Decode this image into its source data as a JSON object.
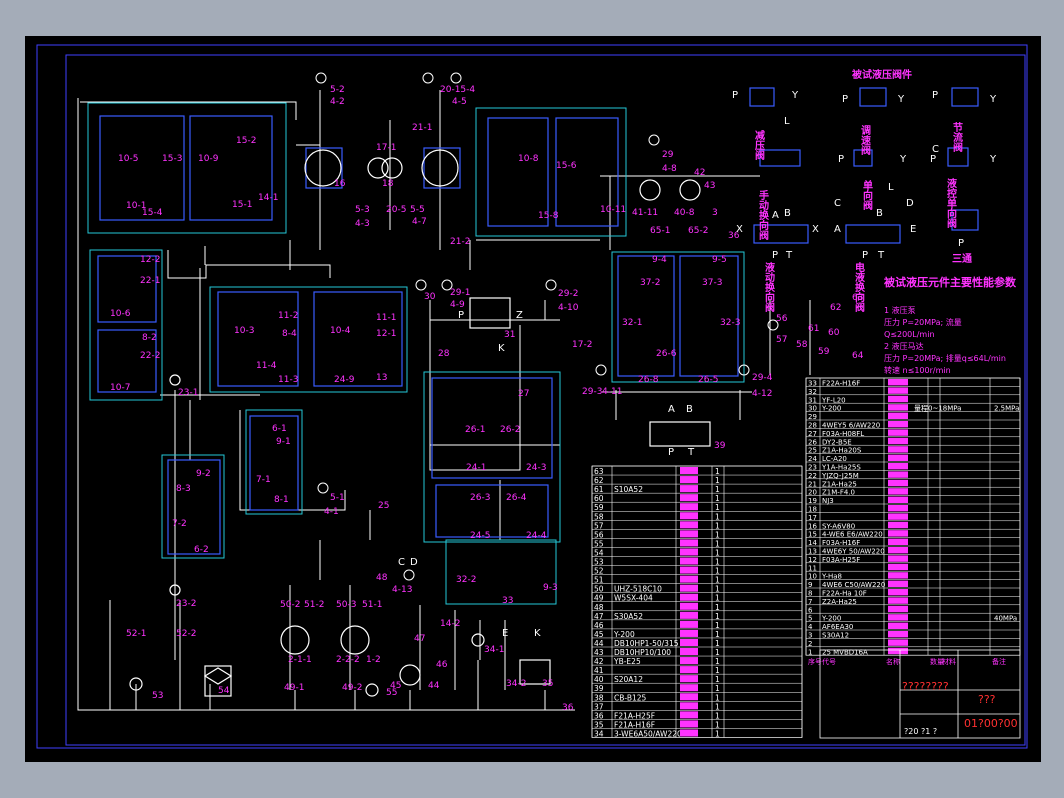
{
  "colors": {
    "background": "#000000",
    "frame": "#4040ff",
    "circuit": "#ffffff",
    "dashed_box": "#25c8d8",
    "labels": "#ff33ff",
    "components": "#3a5cff",
    "accent_red": "#ff3030",
    "outer": "#a4acb8"
  },
  "lbl": {
    "l5_2": "5-2",
    "l4_2": "4-2",
    "l20_15_4": "20-15-4",
    "l4_5": "4-5",
    "l17_1": "17-1",
    "l21_1": "21-1",
    "l16": "16",
    "l18": "18",
    "l5_3": "5-3",
    "l4_3": "4-3",
    "l20_5": "20-5",
    "l5_5": "5-5",
    "l4_7": "4-7",
    "l21_2": "21-2",
    "l29": "29",
    "l4_8": "4-8",
    "l42": "42",
    "l43": "43",
    "l41_11": "41-11",
    "l40_8": "40-8",
    "l3": "3",
    "l65_1": "65-1",
    "l65_2": "65-2",
    "l36": "36",
    "l10_5": "10-5",
    "l15_3": "15-3",
    "l15_2": "15-2",
    "l10_9": "10-9",
    "l10_1": "10-1",
    "l15_4": "15-4",
    "l15_1": "15-1",
    "l14_1": "14-1",
    "l10_8": "10-8",
    "l15_6": "15-6",
    "l10_11": "10-11",
    "l15_8": "15-8",
    "l12_2": "12-2",
    "l22_1": "22-1",
    "l10_6": "10-6",
    "l8_2": "8-2",
    "l22_2": "22-2",
    "l10_7": "10-7",
    "l23_1": "23-1",
    "l11_2": "11-2",
    "l10_3": "10-3",
    "l8_4": "8-4",
    "l11_4": "11-4",
    "l11_1": "11-1",
    "l10_4": "10-4",
    "l12_1": "12-1",
    "l11_3": "11-3",
    "l24_9": "24-9",
    "l13": "13",
    "l30": "30",
    "l29_1": "29-1",
    "l4_9": "4-9",
    "l31": "31",
    "l29_2": "29-2",
    "l4_10": "4-10",
    "l17_2": "17-2",
    "l28": "28",
    "lP": "P",
    "lZ": "Z",
    "lK": "K",
    "lY": "Y",
    "lB": "B",
    "lC": "C",
    "lD": "D",
    "lA": "A",
    "lT": "T",
    "lE": "E",
    "lX": "X",
    "lL": "L",
    "l9_4": "9-4",
    "l9_5": "9-5",
    "l37_2": "37-2",
    "l37_3": "37-3",
    "l32_1": "32-1",
    "l32_3": "32-3",
    "l26_6": "26-6",
    "l26_8": "26-8",
    "l26_5": "26-5",
    "l29_3": "29-3",
    "l4_11": "4-11",
    "l29_4": "29-4",
    "l4_12": "4-12",
    "l39": "39",
    "l27": "27",
    "l26_1": "26-1",
    "l26_2": "26-2",
    "l24_3": "24-3",
    "l24_1": "24-1",
    "l26_3": "26-3",
    "l26_4": "26-4",
    "l24_5": "24-5",
    "l24_4": "24-4",
    "l32_2": "32-2",
    "l33": "33",
    "l9_3": "9-3",
    "l6_1": "6-1",
    "l9_1": "9-1",
    "l7_1": "7-1",
    "l8_1": "8-1",
    "l5_1": "5-1",
    "l4_1": "4-1",
    "l25": "25",
    "l9_2": "9-2",
    "l8_3": "8-3",
    "l7_2": "7-2",
    "l6_2": "6-2",
    "l23_2": "23-2",
    "l52_1": "52-1",
    "l52_2": "52-2",
    "l50_2": "50-2",
    "l51_2": "51-2",
    "l50_3": "50-3",
    "l51_1": "51-1",
    "l2_1_1": "2-1-1",
    "l2_2_2": "2-2-2",
    "l2_2": "2-2",
    "l1_2": "1-2",
    "l49_1": "49-1",
    "l49_2": "49-2",
    "l55": "55",
    "l53": "53",
    "l54": "54",
    "l48": "48",
    "l4_13": "4-13",
    "l14_2": "14-2",
    "l47": "47",
    "l46": "46",
    "l45": "45",
    "l44": "44",
    "l34_1": "34-1",
    "l34_2": "34-2",
    "l35": "35",
    "l56": "56",
    "l57": "57",
    "l58": "58",
    "l59": "59",
    "l60": "60",
    "l61": "61",
    "l62": "62",
    "l63": "63",
    "l64": "64"
  },
  "legend_labels": {
    "pressure_relief": "减压阀",
    "manual_dir": "手动换向阀",
    "hydraulic_dir": "液动换向阀",
    "tested_valve": "被试液压阀件",
    "throttle": "调速阀",
    "check": "单向阀",
    "electro_hyd": "电液换向阀",
    "throttle2": "节流阀",
    "pilot_check": "液控单向阀",
    "three_way": "三通",
    "spec_title": "被试液压元件主要性能参数",
    "spec_1": "1  液压泵",
    "spec_2": "压力 P=20MPa; 流量",
    "spec_3": "Q≤200L/min",
    "spec_4": "2  液压马达",
    "spec_5": "压力 P=20MPa; 排量q≤64L/min",
    "spec_6": "转速 n≤100r/min"
  },
  "bom_left": {
    "nums": [
      "63",
      "62",
      "61",
      "60",
      "59",
      "58",
      "57",
      "56",
      "55",
      "54",
      "53",
      "52",
      "51",
      "50",
      "49",
      "48",
      "47",
      "46",
      "45",
      "44",
      "43",
      "42",
      "41",
      "40",
      "39",
      "38",
      "37",
      "36",
      "35",
      "34"
    ],
    "codes": [
      "",
      "",
      "S10A52",
      "",
      "",
      "",
      "",
      "",
      "",
      "",
      "",
      "",
      "",
      "UHZ-518C10",
      "W5SX-404",
      "",
      "S30A52",
      "",
      "Y-200",
      "DB10HP1-50/315",
      "DB10HP10/100",
      "YB-E25",
      "",
      "S20A12",
      "",
      "CB-B125",
      "",
      "F21A-H25F",
      "F21A-H16F",
      "3-WE6A50/AW220",
      "LC-A40"
    ]
  },
  "bom_right": {
    "rows": [
      [
        "33",
        "F22A-H16F",
        "",
        "",
        "",
        ""
      ],
      [
        "32",
        "",
        "",
        "",
        "",
        ""
      ],
      [
        "31",
        "YF-L20",
        "",
        "",
        "",
        ""
      ],
      [
        "30",
        "Y-200",
        "量程0~18MPa",
        "",
        "2.5MPa",
        ""
      ],
      [
        "29",
        "",
        "",
        "",
        "",
        ""
      ],
      [
        "28",
        "4WEY5 6/AW220",
        "",
        "",
        "",
        ""
      ],
      [
        "27",
        "F03A-H08FL",
        "",
        "",
        "",
        ""
      ],
      [
        "26",
        "DY2-B5E",
        "",
        "",
        "",
        ""
      ],
      [
        "25",
        "Z1A-Ha20S",
        "",
        "",
        "",
        ""
      ],
      [
        "24",
        "LC-A20",
        "",
        "",
        "",
        ""
      ],
      [
        "23",
        "Y1A-Ha25S",
        "",
        "",
        "",
        ""
      ],
      [
        "22",
        "YJZQ-J25M",
        "",
        "",
        "",
        ""
      ],
      [
        "21",
        "Z1A-Ha25",
        "",
        "",
        "",
        ""
      ],
      [
        "20",
        "Z1M-F4.0",
        "",
        "",
        "",
        ""
      ],
      [
        "19",
        "NJ3",
        "",
        "",
        "",
        ""
      ],
      [
        "18",
        "",
        "",
        "",
        "",
        ""
      ],
      [
        "17",
        "",
        "",
        "",
        "",
        ""
      ],
      [
        "16",
        "SY-A6V80",
        "",
        "",
        "",
        ""
      ],
      [
        "15",
        "4-WE6 E6/AW220",
        "",
        "",
        "",
        ""
      ],
      [
        "14",
        "F03A-H16F",
        "",
        "",
        "",
        ""
      ],
      [
        "13",
        "4WE6Y 50/AW220",
        "",
        "",
        "",
        ""
      ],
      [
        "12",
        "F03A-H25F",
        "",
        "",
        "",
        ""
      ],
      [
        "11",
        "",
        "",
        "",
        "",
        ""
      ],
      [
        "10",
        "Y-Ha8",
        "",
        "",
        "",
        ""
      ],
      [
        "9",
        "4WE6 C50/AW220",
        "",
        "",
        "",
        ""
      ],
      [
        "8",
        "F22A-Ha 10F",
        "",
        "",
        "",
        ""
      ],
      [
        "7",
        "Z2A-Ha25",
        "",
        "",
        "",
        ""
      ],
      [
        "6",
        "",
        "",
        "",
        "",
        ""
      ],
      [
        "5",
        "Y-200",
        "",
        "",
        "40MPa",
        ""
      ],
      [
        "4",
        "AF6EA30",
        "",
        "",
        "",
        ""
      ],
      [
        "3",
        "S30A12",
        "",
        "",
        "",
        ""
      ],
      [
        "2",
        "",
        "",
        "",
        "",
        ""
      ],
      [
        "1",
        "25 MVBD16A",
        "",
        "",
        "",
        ""
      ]
    ],
    "header": [
      "序号",
      "代号",
      "名称",
      "数量",
      "材料",
      "备注"
    ],
    "unknown_a": "????????",
    "unknown_b": "???",
    "sheet_no": "01?00?00",
    "sheet_sub": "?20 ?1 ?"
  }
}
